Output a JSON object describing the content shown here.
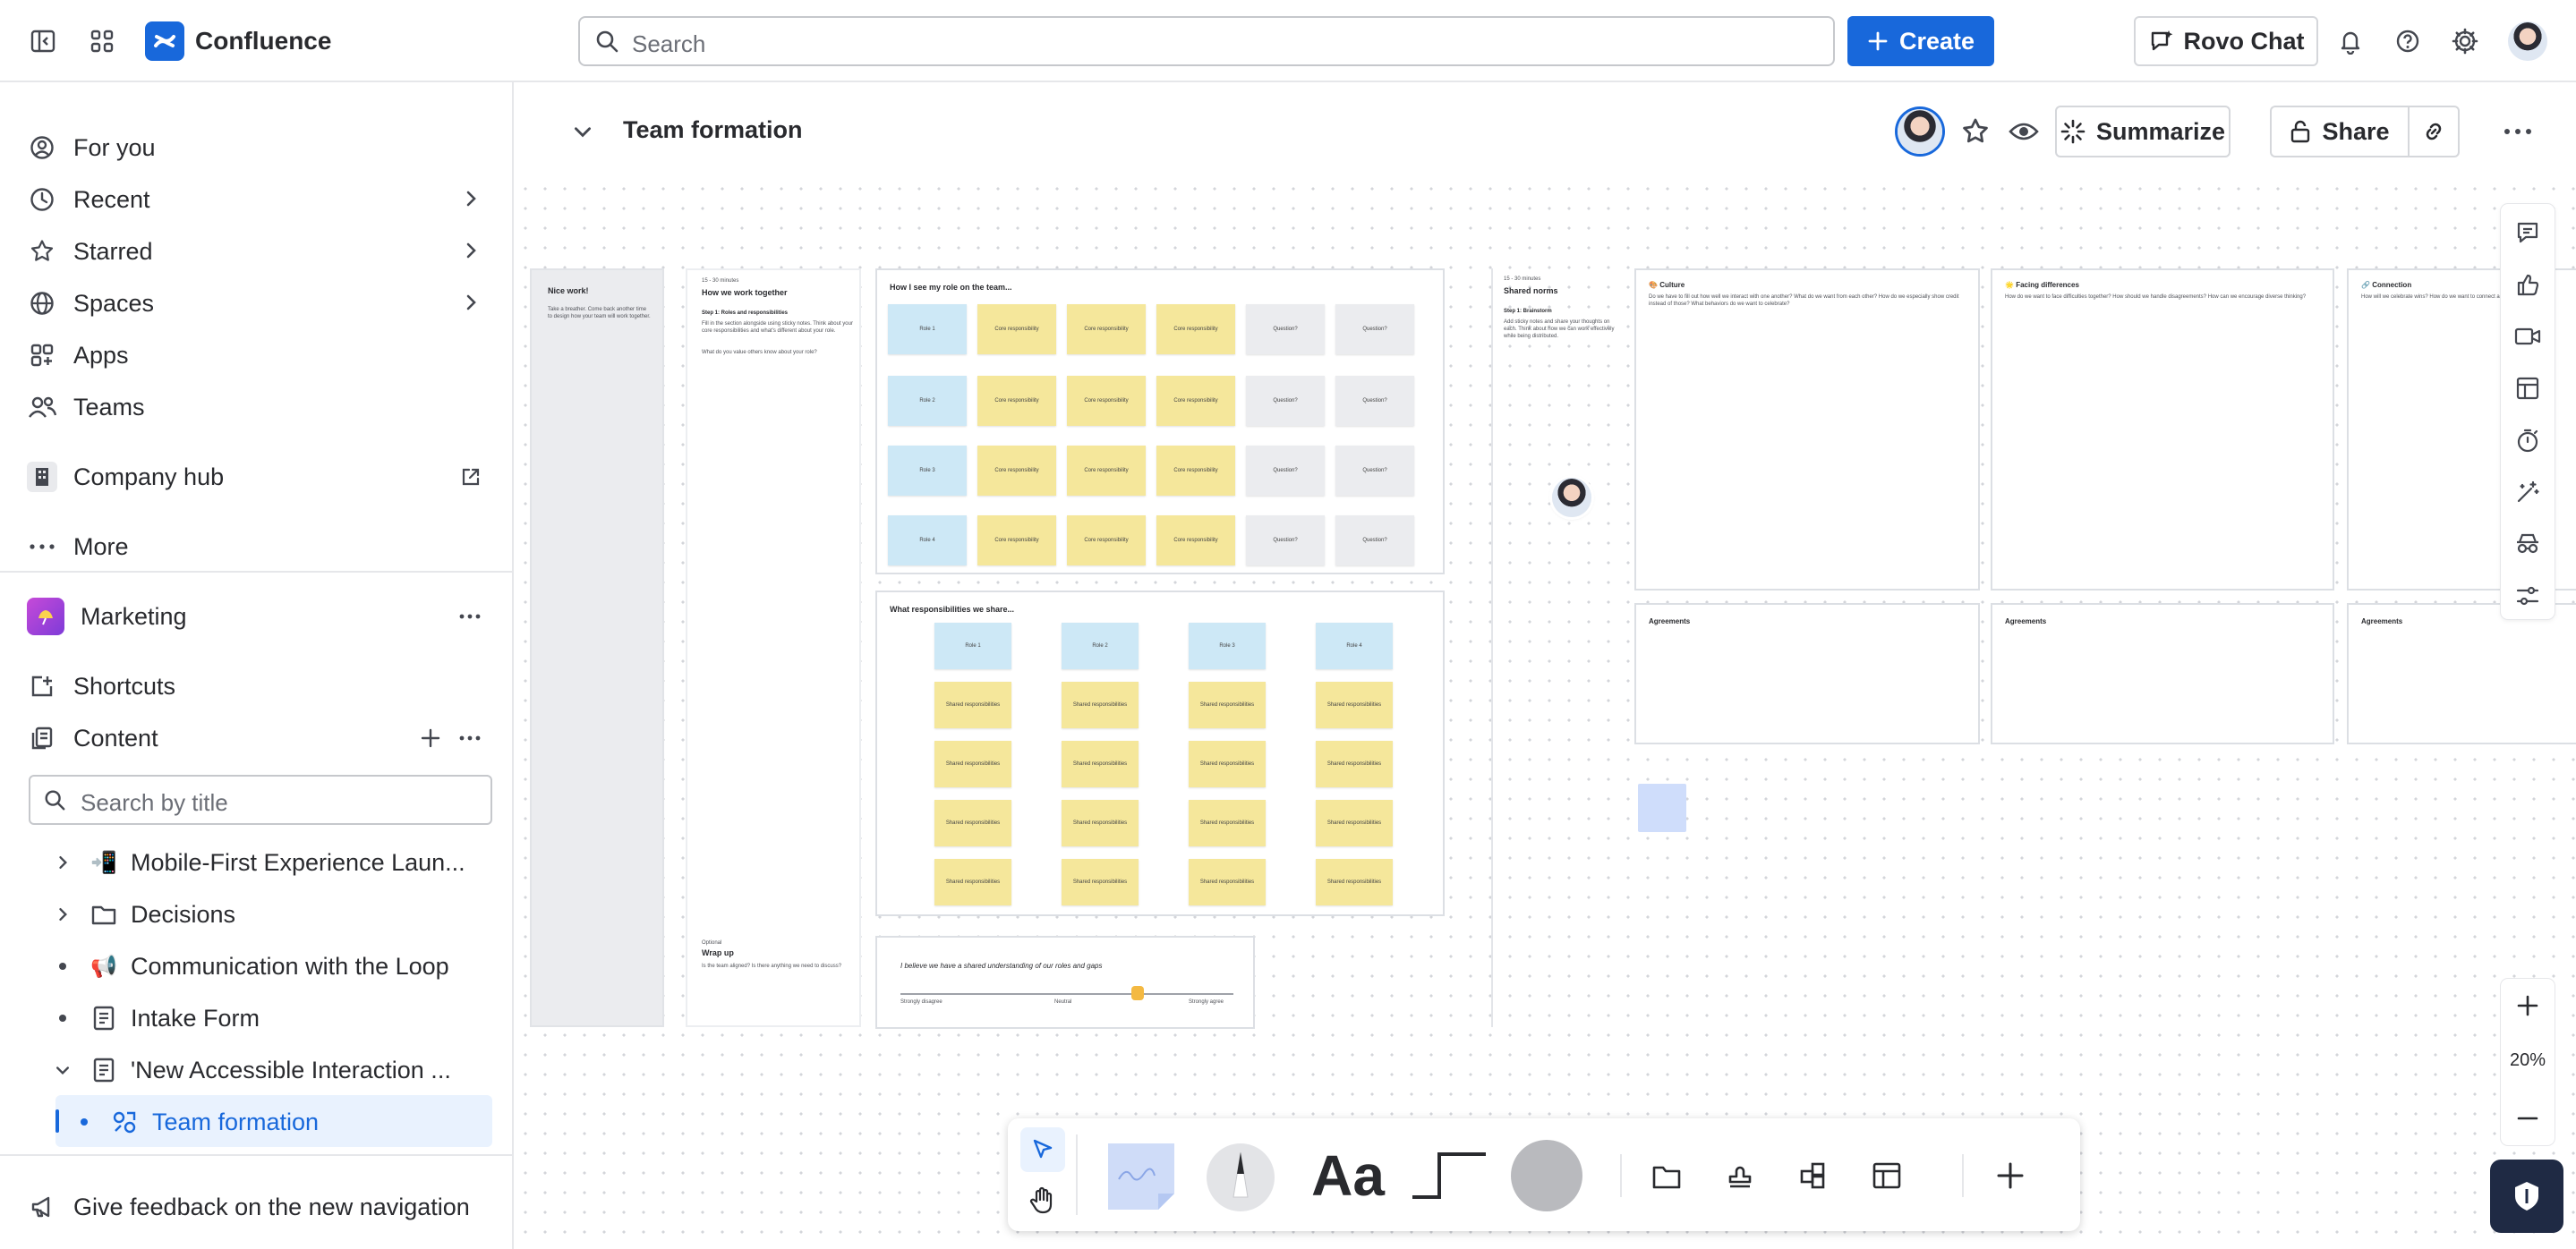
{
  "topbar": {
    "app_name": "Confluence",
    "search_placeholder": "Search",
    "create_label": "Create",
    "rovo_label": "Rovo Chat"
  },
  "sidebar": {
    "nav": [
      {
        "label": "For you"
      },
      {
        "label": "Recent"
      },
      {
        "label": "Starred"
      },
      {
        "label": "Spaces"
      },
      {
        "label": "Apps"
      },
      {
        "label": "Teams"
      }
    ],
    "company_hub": "Company hub",
    "more": "More",
    "space_name": "Marketing",
    "shortcuts": "Shortcuts",
    "content": "Content",
    "title_search_placeholder": "Search by title",
    "tree": [
      {
        "label": "Mobile-First Experience Laun...",
        "icon": "📲"
      },
      {
        "label": "Decisions"
      },
      {
        "label": "Communication with the Loop",
        "icon": "📢"
      },
      {
        "label": "Intake Form"
      },
      {
        "label": "'New Accessible Interaction ..."
      },
      {
        "label": "Team formation"
      }
    ],
    "feedback": "Give feedback on the new navigation"
  },
  "page": {
    "title": "Team formation",
    "summarize_label": "Summarize",
    "share_label": "Share"
  },
  "whiteboard": {
    "nice_work": {
      "title": "Nice work!",
      "body": "Take a breather. Come back another time to design how your team will work together."
    },
    "how_we_work": {
      "time": "15 - 30 minutes",
      "title": "How we work together",
      "step": "Step 1: Roles and responsibilities",
      "body": "Fill in the section alongside using sticky notes. Think about your core responsibilities and what's different about your role.",
      "q": "What do you value others know about your role?"
    },
    "role_section": {
      "title": "How I see my role on the team...",
      "roles": [
        "Role 1",
        "Role 2",
        "Role 3",
        "Role 4"
      ],
      "core": "Core responsibility",
      "question": "Question?"
    },
    "shared_section": {
      "title": "What responsibilities we share...",
      "roles": [
        "Role 1",
        "Role 2",
        "Role 3",
        "Role 4"
      ],
      "shared": "Shared responsibilities"
    },
    "wrap_up": {
      "tag": "Optional",
      "title": "Wrap up",
      "body": "Is the team aligned? Is there anything we need to discuss?",
      "statement": "I believe we have a shared understanding of our roles and gaps",
      "scale": [
        "Strongly disagree",
        "Neutral",
        "Strongly agree"
      ]
    },
    "shared_norms": {
      "time": "15 - 30 minutes",
      "title": "Shared norms",
      "step": "Step 1: Brainstorm",
      "body": "Add sticky notes and share your thoughts on each. Think about how we can work effectively while being distributed."
    },
    "culture": {
      "title": "Culture",
      "emoji": "🎨",
      "body": "Do we have to fill out how well we interact with one another? What do we want from each other? How do we especially show credit instead of those? What behaviors do we want to celebrate?"
    },
    "facing": {
      "title": "Facing differences",
      "emoji": "🌟",
      "body": "How do we want to face difficulties together? How should we handle disagreements? How can we encourage diverse thinking?"
    },
    "connection": {
      "title": "Connection",
      "emoji": "🔗",
      "body": "How will we celebrate wins? How do we want to connect as a team?"
    },
    "agreements": "Agreements"
  },
  "zoom": {
    "level": "20%"
  }
}
